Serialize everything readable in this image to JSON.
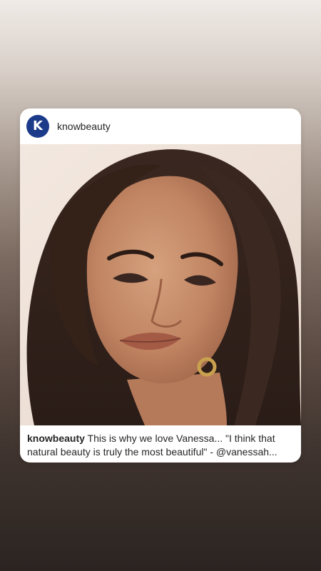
{
  "post": {
    "username": "knowbeauty",
    "avatar_letter": "K",
    "caption_user": "knowbeauty",
    "caption_text": "This is why we love Vanessa... \"I think that natural beauty is truly the most beautiful\" - @vanessah...",
    "photo_icon": "portrait-photo"
  },
  "colors": {
    "avatar_bg": "#1b3a8a",
    "card_bg": "#ffffff",
    "text": "#262626"
  }
}
